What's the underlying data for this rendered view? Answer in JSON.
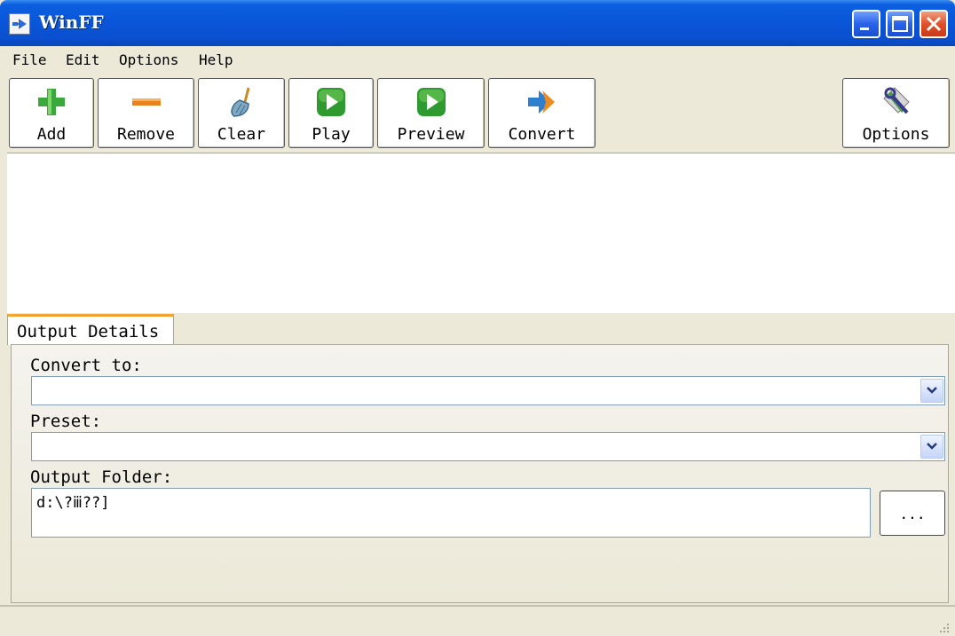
{
  "window": {
    "title": "WinFF"
  },
  "menu": {
    "items": [
      "File",
      "Edit",
      "Options",
      "Help"
    ]
  },
  "toolbar": {
    "add": "Add",
    "remove": "Remove",
    "clear": "Clear",
    "play": "Play",
    "preview": "Preview",
    "convert": "Convert",
    "options": "Options"
  },
  "details": {
    "tab_label": "Output Details",
    "convert_to_label": "Convert to:",
    "convert_to_value": "",
    "preset_label": "Preset:",
    "preset_value": "",
    "output_folder_label": "Output Folder:",
    "output_folder_value": "d:\\?ⅲ??]",
    "browse_label": "..."
  },
  "icons": {
    "app": "app-icon",
    "add": "plus-icon",
    "remove": "minus-icon",
    "clear": "broom-icon",
    "play": "play-icon",
    "preview": "play-icon",
    "convert": "convert-arrow-icon",
    "options": "wrench-icon"
  },
  "colors": {
    "titlebar": "#0a55d8",
    "close": "#e0502a",
    "tab_accent": "#f0a630"
  }
}
